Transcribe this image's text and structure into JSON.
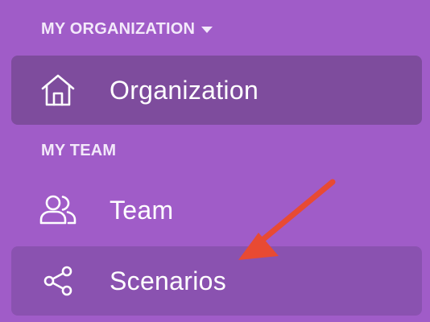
{
  "sidebar": {
    "org_section": {
      "label": "MY ORGANIZATION",
      "caret_icon": "caret-down-icon"
    },
    "team_section": {
      "label": "MY TEAM"
    },
    "items": [
      {
        "label": "Organization",
        "icon": "home-icon",
        "state": "active"
      },
      {
        "label": "Team",
        "icon": "users-icon",
        "state": "default"
      },
      {
        "label": "Scenarios",
        "icon": "share-icon",
        "state": "hover"
      }
    ]
  },
  "annotation": {
    "icon": "arrow-annotation",
    "color": "#e84a33"
  },
  "colors": {
    "background": "#a05cc8",
    "active_item": "#7e4c9d",
    "hover_item": "#8a52b0",
    "text": "#ffffff"
  }
}
